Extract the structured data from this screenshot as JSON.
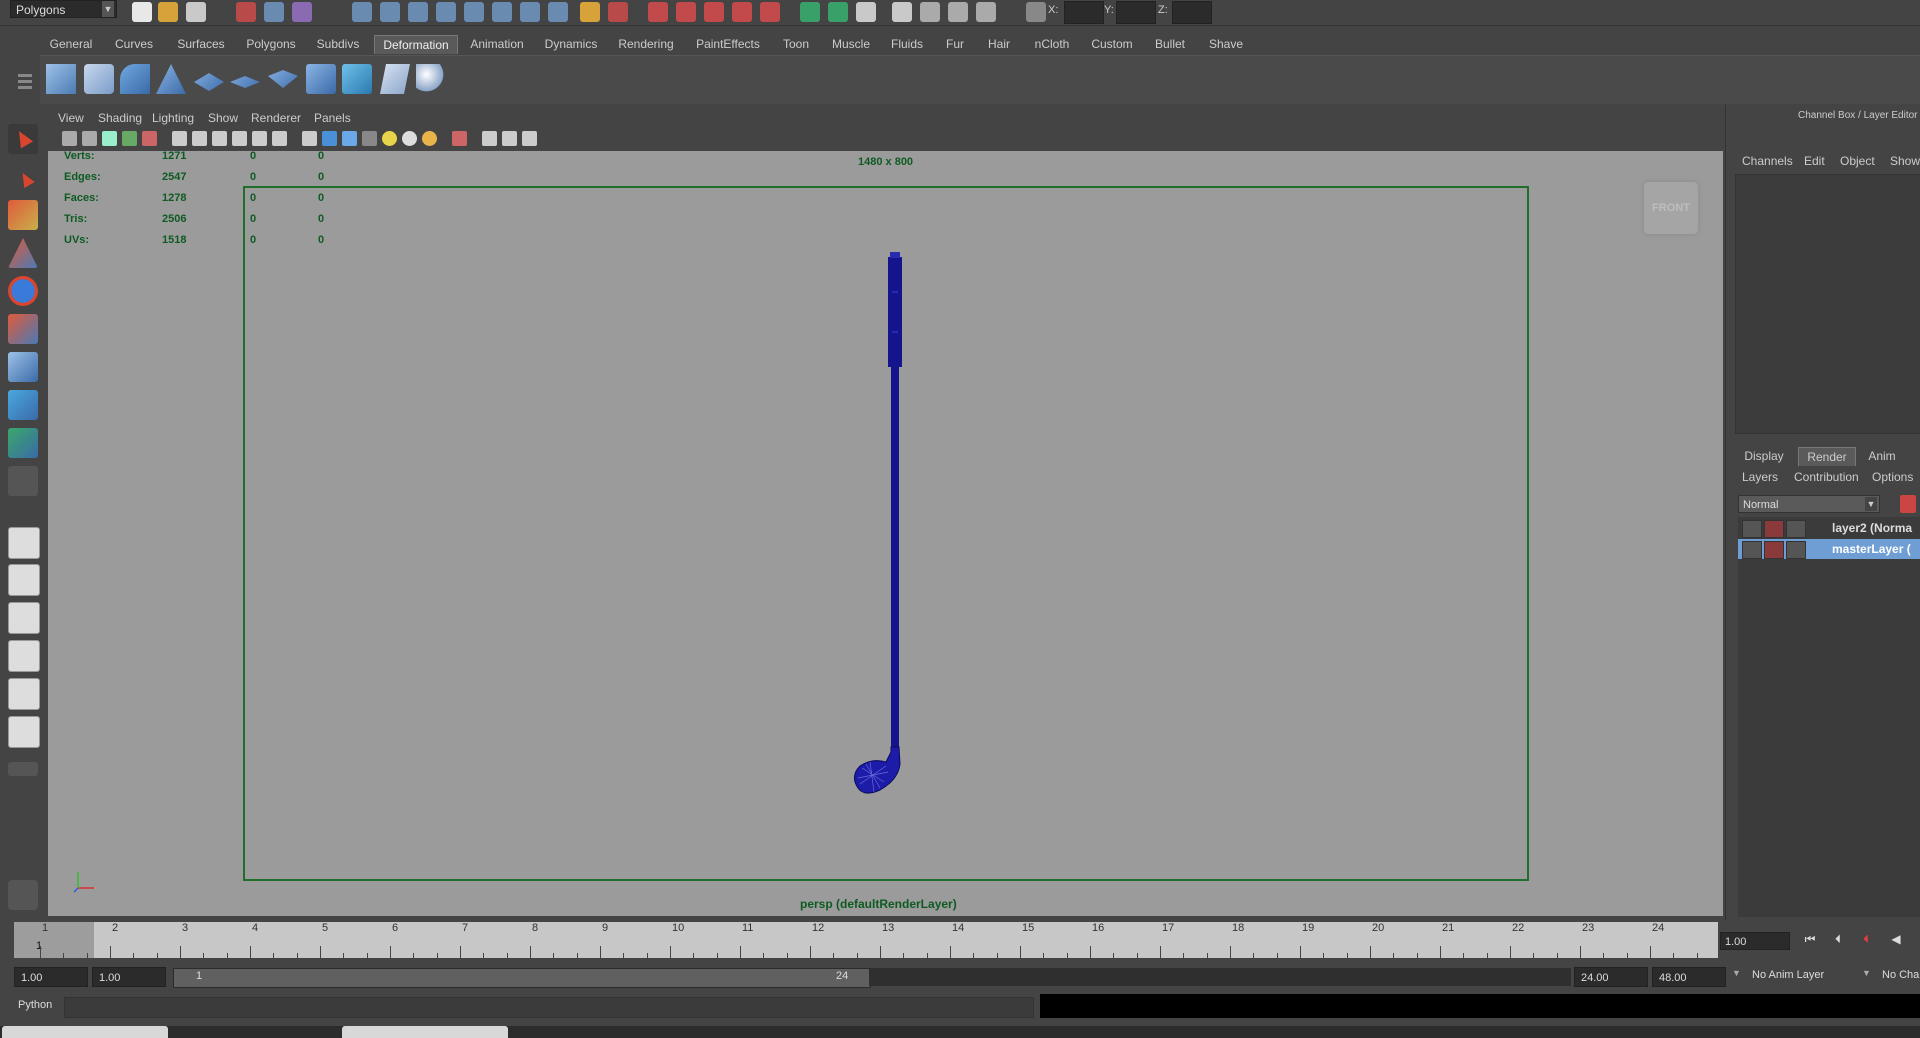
{
  "status_line": {
    "mode": "Polygons",
    "coord_labels": [
      "X:",
      "Y:",
      "Z:"
    ]
  },
  "shelf_tabs": [
    "General",
    "Curves",
    "Surfaces",
    "Polygons",
    "Subdivs",
    "Deformation",
    "Animation",
    "Dynamics",
    "Rendering",
    "PaintEffects",
    "Toon",
    "Muscle",
    "Fluids",
    "Fur",
    "Hair",
    "nCloth",
    "Custom",
    "Bullet",
    "Shave"
  ],
  "active_shelf_tab": "Deformation",
  "panel_menu": [
    "View",
    "Shading",
    "Lighting",
    "Show",
    "Renderer",
    "Panels"
  ],
  "hud": {
    "rows": [
      {
        "label": "Verts:",
        "a": "1271",
        "b": "0",
        "c": "0"
      },
      {
        "label": "Edges:",
        "a": "2547",
        "b": "0",
        "c": "0"
      },
      {
        "label": "Faces:",
        "a": "1278",
        "b": "0",
        "c": "0"
      },
      {
        "label": "Tris:",
        "a": "2506",
        "b": "0",
        "c": "0"
      },
      {
        "label": "UVs:",
        "a": "1518",
        "b": "0",
        "c": "0"
      }
    ],
    "resolution": "1480 x 800",
    "camera": "persp (defaultRenderLayer)",
    "view_cube": "FRONT"
  },
  "channel_box": {
    "title": "Channel Box / Layer Editor",
    "menu": [
      "Channels",
      "Edit",
      "Object",
      "Show"
    ]
  },
  "layer_editor": {
    "tabs": [
      "Display",
      "Render",
      "Anim"
    ],
    "active_tab": "Render",
    "menu": [
      "Layers",
      "Contribution",
      "Options"
    ],
    "blend_mode": "Normal",
    "layers": [
      {
        "name": "layer2 (Norma",
        "selected": false
      },
      {
        "name": "masterLayer (",
        "selected": true
      }
    ]
  },
  "timeline": {
    "ticks": [
      "1",
      "2",
      "3",
      "4",
      "5",
      "6",
      "7",
      "8",
      "9",
      "10",
      "11",
      "12",
      "13",
      "14",
      "15",
      "16",
      "17",
      "18",
      "19",
      "20",
      "21",
      "22",
      "23",
      "24"
    ],
    "current_frame": "1",
    "current_time_field": "1.00"
  },
  "range": {
    "start_time": "1.00",
    "playback_start": "1.00",
    "slider_start": "1",
    "slider_end": "24",
    "playback_end": "24.00",
    "end_time": "48.00",
    "anim_layer": "No Anim Layer",
    "character": "No Cha"
  },
  "command_line": {
    "language": "Python"
  },
  "colors": {
    "hud_green": "#0e5b22",
    "viewport_bg": "#9b9b9b",
    "model": "#14148c",
    "selected_layer": "#6e9ed4"
  }
}
